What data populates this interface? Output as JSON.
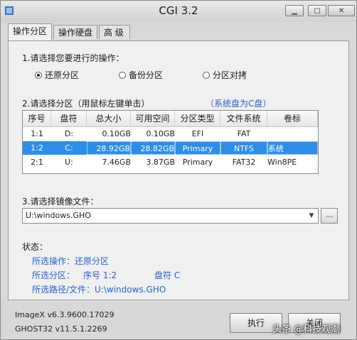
{
  "window": {
    "title": "CGI 3.2"
  },
  "tabs": [
    {
      "label": "操作分区",
      "active": true
    },
    {
      "label": "操作硬盘",
      "active": false
    },
    {
      "label": "高  级",
      "active": false
    }
  ],
  "section1": {
    "label": "1.请选择您要进行的操作：",
    "options": [
      {
        "label": "还原分区",
        "selected": true
      },
      {
        "label": "备份分区",
        "selected": false
      },
      {
        "label": "分区对拷",
        "selected": false
      }
    ]
  },
  "section2": {
    "label": "2.请选择分区（用鼠标左键单击）",
    "hint": "（系统盘为C盘）",
    "columns": [
      "序号",
      "盘符",
      "总大小",
      "可用空间",
      "分区类型",
      "文件系统",
      "卷标"
    ],
    "rows": [
      {
        "no": "1:1",
        "drive": "D:",
        "total": "0.10GB",
        "free": "0.10GB",
        "type": "EFI",
        "fs": "FAT",
        "label": "",
        "selected": false
      },
      {
        "no": "1:2",
        "drive": "C:",
        "total": "28.92GB",
        "free": "28.82GB",
        "type": "Primary",
        "fs": "NTFS",
        "label": "系统",
        "selected": true
      },
      {
        "no": "2:1",
        "drive": "U:",
        "total": "7.46GB",
        "free": "3.87GB",
        "type": "Primary",
        "fs": "FAT32",
        "label": "Win8PE",
        "selected": false
      }
    ]
  },
  "section3": {
    "label": "3.请选择镜像文件：",
    "file_value": "U:\\windows.GHO",
    "browse_label": "..."
  },
  "status": {
    "title": "状态：",
    "operation": "所选操作：还原分区",
    "partition_label": "所选分区：",
    "partition_no": "序号 1:2",
    "partition_drive": "盘符 C",
    "path": "所选路径/文件：U:\\windows.GHO"
  },
  "versions": {
    "imagex": "ImageX v6.3.9600.17029",
    "ghost": "GHOST32 v11.5.1.2269"
  },
  "buttons": {
    "execute": "执行",
    "close": "关闭"
  },
  "watermark": "头条 @科技观潮",
  "colors": {
    "selection": "#2e8ee6",
    "status_text": "#2b61c9"
  }
}
